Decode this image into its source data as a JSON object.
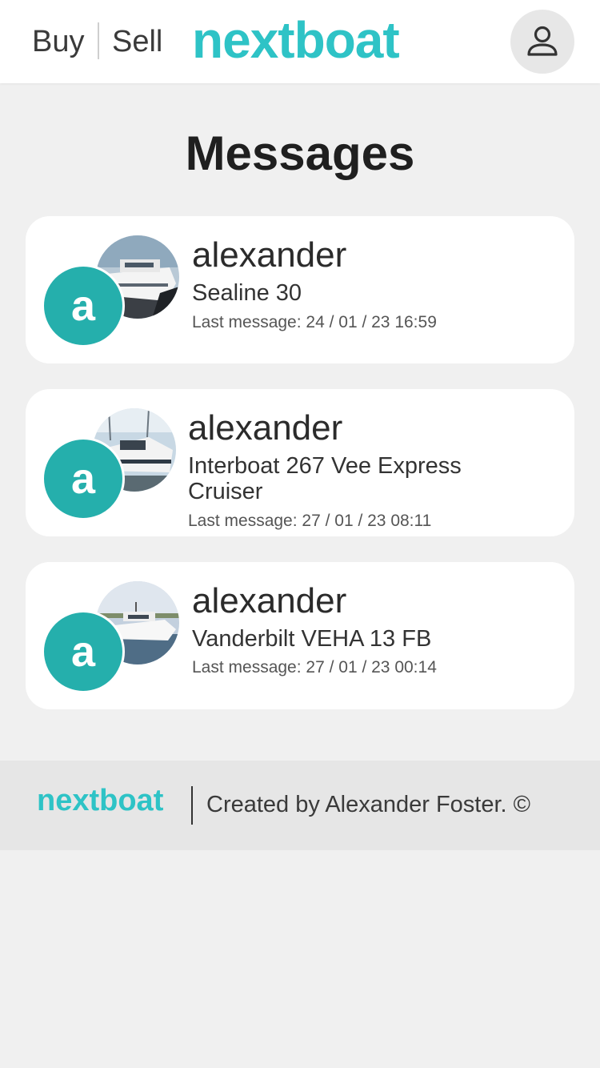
{
  "header": {
    "buy_label": "Buy",
    "sell_label": "Sell",
    "brand": "nextboat"
  },
  "page": {
    "title": "Messages"
  },
  "conversations": [
    {
      "avatar_letter": "a",
      "name": "alexander",
      "boat": "Sealine 30",
      "last_message": "Last message: 24 / 01 / 23 16:59"
    },
    {
      "avatar_letter": "a",
      "name": "alexander",
      "boat": "Interboat 267 Vee Express Cruiser",
      "last_message": "Last message: 27 / 01 / 23 08:11"
    },
    {
      "avatar_letter": "a",
      "name": "alexander",
      "boat": "Vanderbilt VEHA 13 FB",
      "last_message": "Last message: 27 / 01 / 23 00:14"
    }
  ],
  "footer": {
    "brand": "nextboat",
    "credit": "Created by Alexander Foster. ©"
  },
  "colors": {
    "brand": "#2ec3c6",
    "avatar": "#25afac",
    "background": "#f0f0f0"
  },
  "icons": {
    "profile": "person-icon"
  }
}
